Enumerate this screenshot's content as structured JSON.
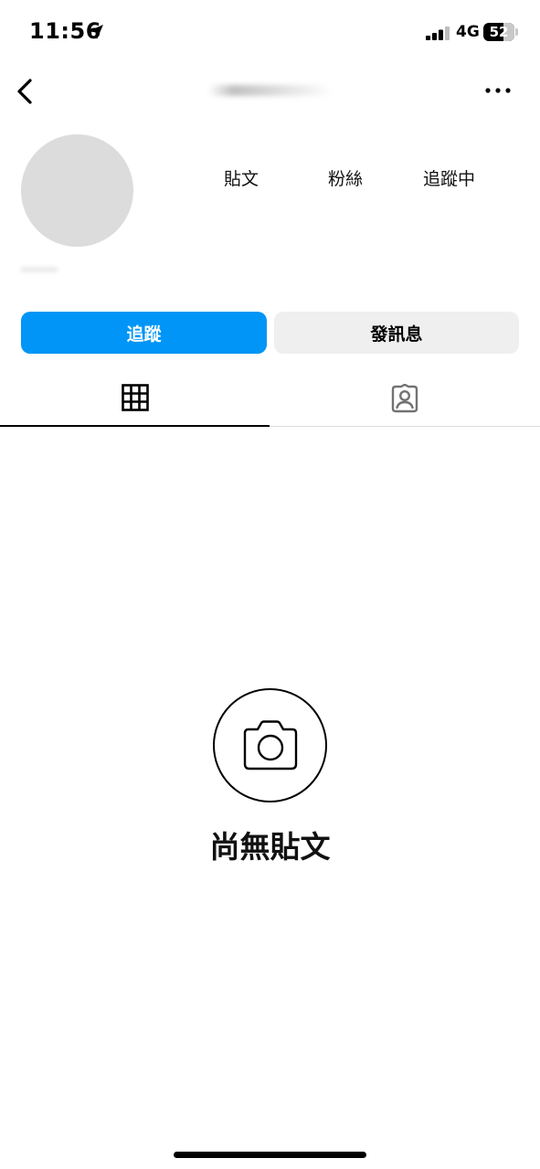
{
  "status_bar": {
    "time": "11:56",
    "network": "4G",
    "battery_level": "52"
  },
  "nav": {
    "back_icon": "chevron-left-icon",
    "more_icon": "ellipsis-icon"
  },
  "profile": {
    "stats": {
      "posts_label": "貼文",
      "followers_label": "粉絲",
      "following_label": "追蹤中"
    }
  },
  "actions": {
    "follow_label": "追蹤",
    "message_label": "發訊息"
  },
  "tabs": [
    {
      "icon": "grid-icon",
      "selected": true
    },
    {
      "icon": "tagged-person-icon",
      "selected": false
    }
  ],
  "empty_state": {
    "icon": "camera-icon",
    "title": "尚無貼文"
  },
  "colors": {
    "primary_blue": "#0095f6",
    "secondary_button": "#efefef",
    "avatar_placeholder": "#dcdcdc"
  }
}
